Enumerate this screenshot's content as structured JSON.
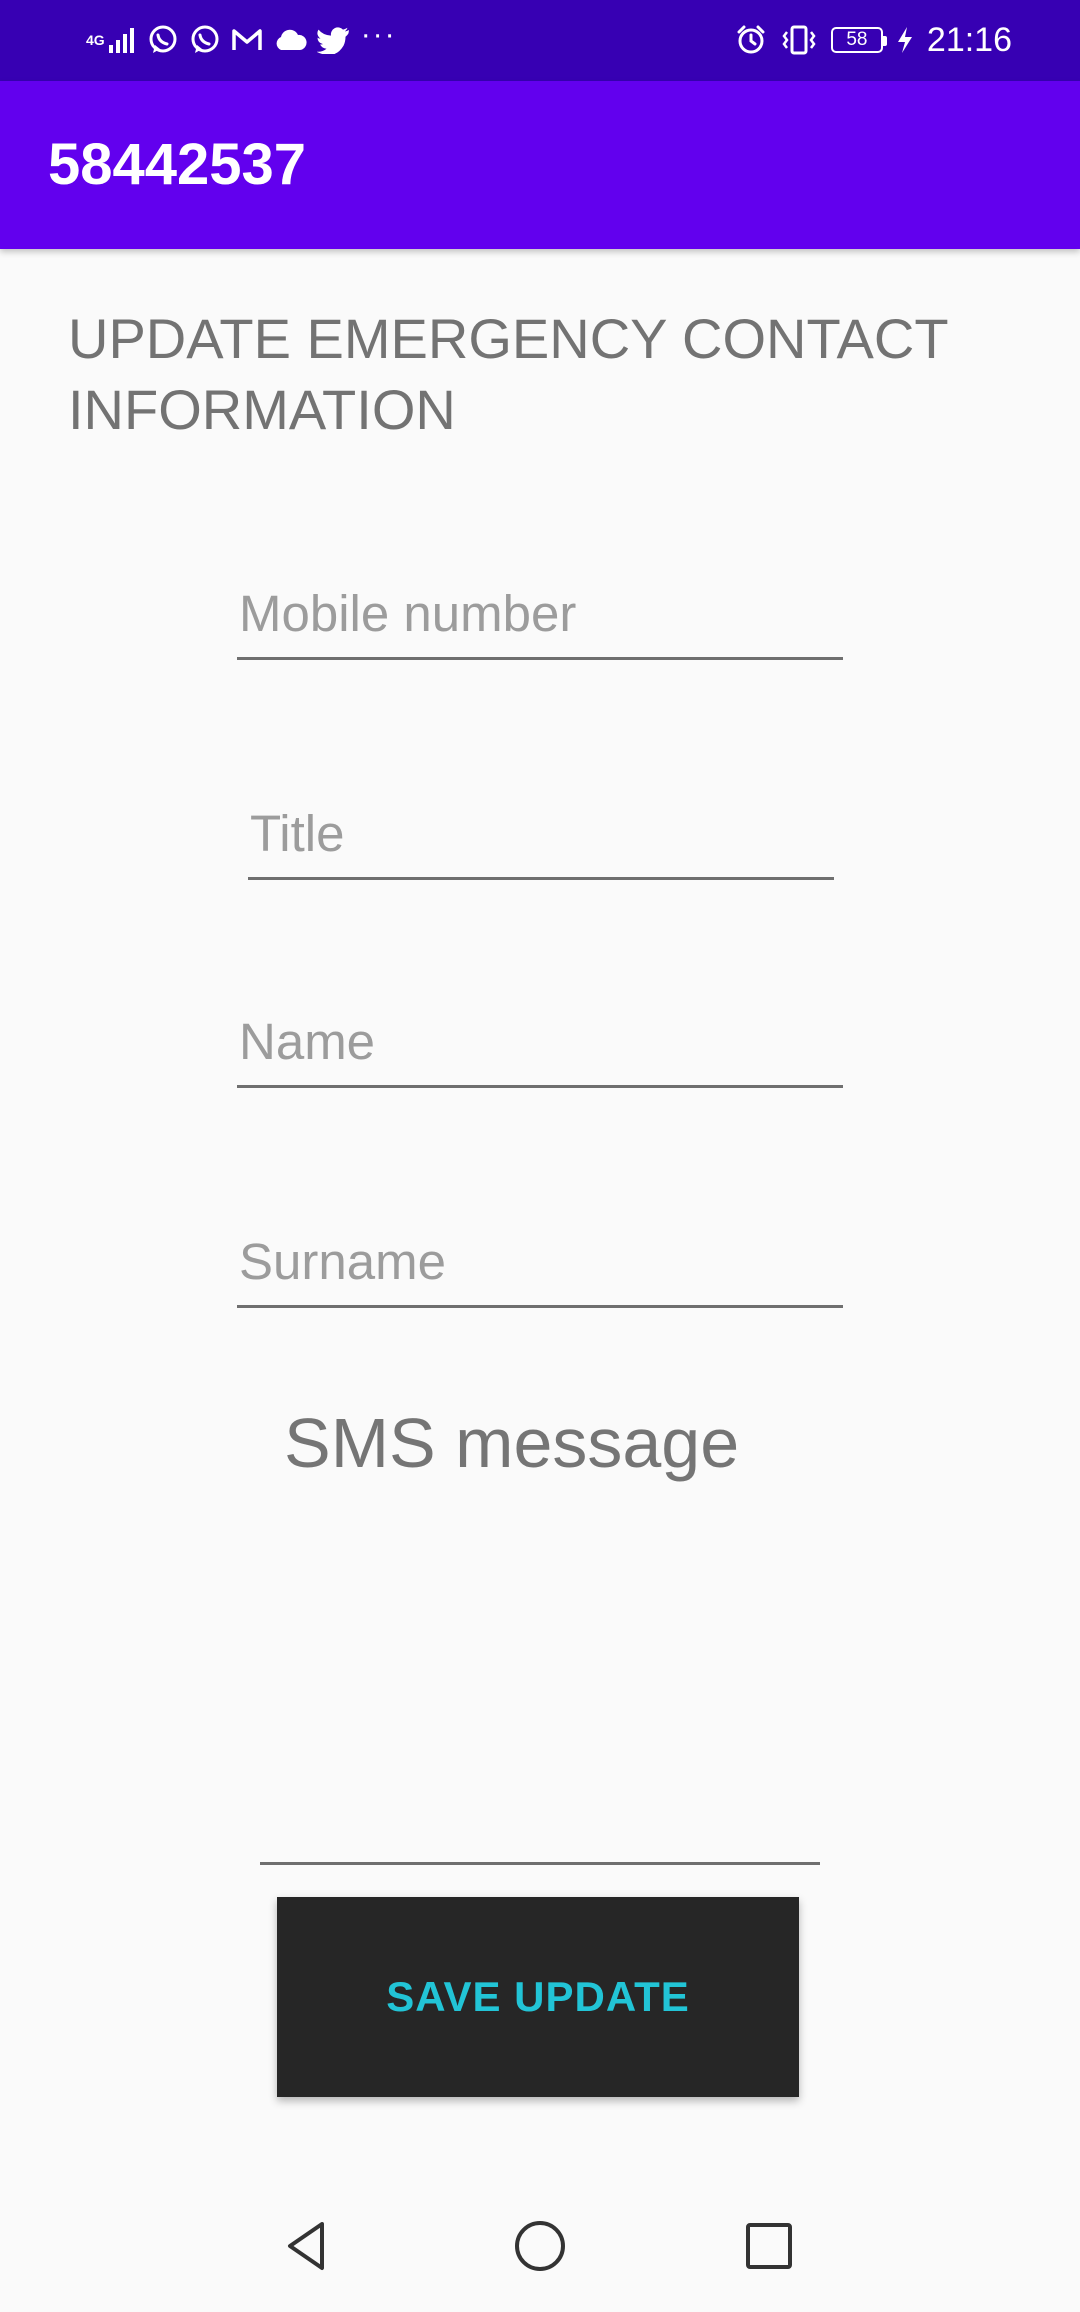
{
  "status_bar": {
    "network_label": "4G",
    "icons_left": [
      "signal-icon",
      "whatsapp-icon",
      "whatsapp-icon",
      "gmail-icon",
      "cloud-icon",
      "twitter-icon",
      "more-notifications-icon"
    ],
    "more": "···",
    "icons_right": [
      "alarm-icon",
      "vibrate-icon",
      "battery-icon",
      "charging-icon"
    ],
    "battery": "58",
    "time": "21:16"
  },
  "app_bar": {
    "title": "58442537",
    "color": "#6200ee"
  },
  "form": {
    "heading": "UPDATE EMERGENCY CONTACT INFORMATION",
    "mobile_placeholder": "Mobile number",
    "title_placeholder": "Title",
    "name_placeholder": "Name",
    "surname_placeholder": "Surname",
    "sms_placeholder": "SMS message",
    "save_label": "SAVE UPDATE"
  },
  "nav_bar": {
    "icons": [
      "back-icon",
      "home-icon",
      "recents-icon"
    ]
  },
  "colors": {
    "status_bar": "#3700b3",
    "app_bar": "#6200ee",
    "button_bg": "#262626",
    "button_text": "#22c4d6"
  }
}
